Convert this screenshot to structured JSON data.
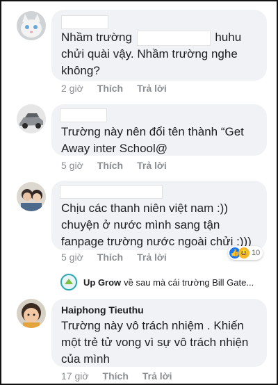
{
  "comments": [
    {
      "text_before": "Nhầm trường ",
      "text_after": " huhu\nchửi quài vậy. Nhầm trường nghe\nkhông?",
      "time": "2 giờ",
      "like": "Thích",
      "reply": "Trả lời"
    },
    {
      "text": "Trường này nên đổi tên thành “Get\nAway inter School@",
      "time": "5 giờ",
      "like": "Thích",
      "reply": "Trả lời"
    },
    {
      "text": "Chịu các thanh niên việt nam :))\nchuyện ở nước mình sang tận\nfanpage trường nước ngoài chửi :)))",
      "time": "5 giờ",
      "like": "Thích",
      "reply": "Trả lời",
      "reaction_count": "10",
      "reply_preview": {
        "author": "Up Grow",
        "text": "về sau mà cái trường Bill Gate..."
      }
    },
    {
      "author": "Haiphong Tieuthu",
      "text": "Trường này vô trách nhiệm . Khiến\nmột trẻ tử vong vì sự vô trách nhiện\ncủa mình",
      "time": "17 giờ",
      "like": "Thích",
      "reply": "Trả lời"
    }
  ],
  "colors": {
    "bubble": "#f0f2f5",
    "meta": "#8a8d91",
    "like_blue": "#1877f2",
    "haha_yellow": "#f7b928"
  }
}
